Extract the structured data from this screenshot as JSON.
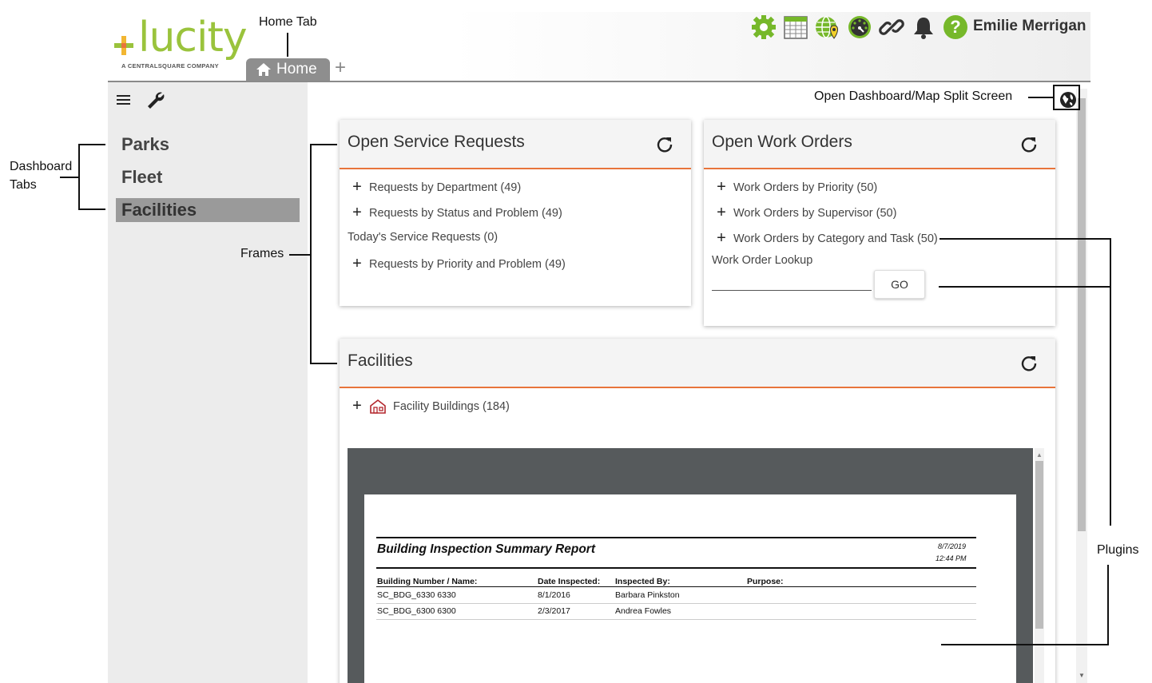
{
  "header": {
    "logo_text": "lucity",
    "logo_subtext": "A CENTRALSQUARE COMPANY",
    "home_tab_label": "Home",
    "add_tab_label": "+",
    "user_name": "Emilie Merrigan",
    "icons": [
      "gear-icon",
      "calendar-icon",
      "globe-map-icon",
      "dashboard-dial-icon",
      "link-icon",
      "bell-icon",
      "help-icon"
    ],
    "accent_green": "#76b82a"
  },
  "sidebar": {
    "tabs": [
      {
        "label": "Parks",
        "active": false
      },
      {
        "label": "Fleet",
        "active": false
      },
      {
        "label": "Facilities",
        "active": true
      }
    ]
  },
  "frames": {
    "service_requests": {
      "title": "Open Service Requests",
      "items": [
        {
          "label": "Requests by Department (49)",
          "expandable": true
        },
        {
          "label": "Requests by Status and Problem (49)",
          "expandable": true
        },
        {
          "label": "Today's Service Requests (0)",
          "expandable": false
        },
        {
          "label": "Requests by Priority and Problem (49)",
          "expandable": true
        }
      ]
    },
    "work_orders": {
      "title": "Open Work Orders",
      "items": [
        {
          "label": "Work Orders by Priority (50)",
          "expandable": true
        },
        {
          "label": "Work Orders by Supervisor (50)",
          "expandable": true
        },
        {
          "label": "Work Orders by Category and Task (50)",
          "expandable": true
        }
      ],
      "lookup_label": "Work Order Lookup",
      "lookup_value": "",
      "go_label": "GO"
    },
    "facilities": {
      "title": "Facilities",
      "items": [
        {
          "label": "Facility Buildings (184)",
          "expandable": true
        }
      ]
    },
    "accent_orange": "#e8743b"
  },
  "report": {
    "title": "Building Inspection Summary Report",
    "date": "8/7/2019",
    "time": "12:44 PM",
    "columns": [
      "Building Number / Name:",
      "Date Inspected:",
      "Inspected By:",
      "Purpose:"
    ],
    "rows": [
      [
        "SC_BDG_6330   6330",
        "8/1/2016",
        "Barbara Pinkston",
        ""
      ],
      [
        "SC_BDG_6300   6300",
        "2/3/2017",
        "Andrea Fowles",
        ""
      ]
    ]
  },
  "annotations": {
    "home_tab": "Home Tab",
    "dashboard_tabs_line1": "Dashboard",
    "dashboard_tabs_line2": "Tabs",
    "frames": "Frames",
    "split_screen": "Open Dashboard/Map Split Screen",
    "plugins": "Plugins"
  }
}
